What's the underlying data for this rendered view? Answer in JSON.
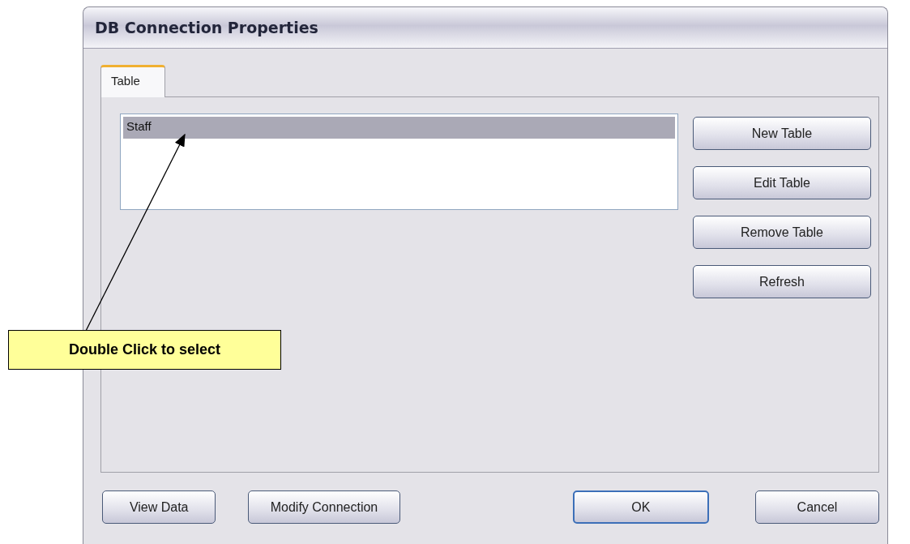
{
  "window": {
    "title": "DB Connection Properties"
  },
  "tabs": [
    {
      "label": "Table",
      "selected": true
    }
  ],
  "tables": [
    {
      "name": "Staff",
      "selected": true
    }
  ],
  "side_buttons": [
    "New Table",
    "Edit Table",
    "Remove Table",
    "Refresh"
  ],
  "bottom_buttons": [
    {
      "label": "View Data",
      "default": false
    },
    {
      "label": "Modify Connection",
      "default": false
    },
    {
      "label": "OK",
      "default": true
    },
    {
      "label": "Cancel",
      "default": false
    }
  ],
  "callout": {
    "text": "Double Click to select"
  }
}
